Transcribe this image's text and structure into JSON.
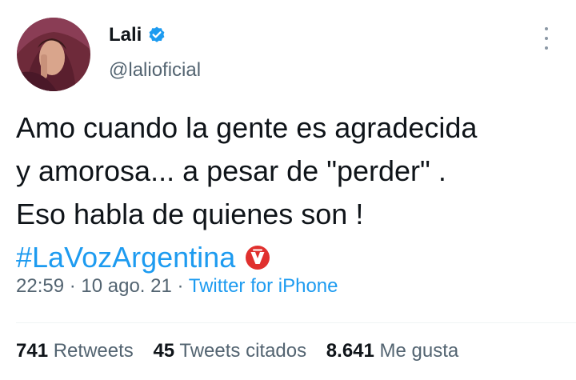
{
  "user": {
    "name": "Lali",
    "handle": "@lalioficial"
  },
  "tweet": {
    "lines": [
      "Amo cuando la gente es agradecida",
      "y amorosa... a pesar de \"perder\" .",
      "Eso habla de quienes son !"
    ],
    "hashtag": "#LaVozArgentina"
  },
  "meta": {
    "time": "22:59",
    "separator": " · ",
    "date": "10 ago. 21",
    "source": "Twitter for iPhone"
  },
  "stats": {
    "retweets_count": "741",
    "retweets_label": "Retweets",
    "quotes_count": "45",
    "quotes_label": "Tweets citados",
    "likes_count": "8.641",
    "likes_label": "Me gusta"
  },
  "colors": {
    "accent": "#1d9bf0",
    "secondary_text": "#536471",
    "hashflag": "#e0302e"
  },
  "icons": [
    "verified-badge-icon",
    "more-options-icon",
    "la-voz-hashflag-icon"
  ]
}
